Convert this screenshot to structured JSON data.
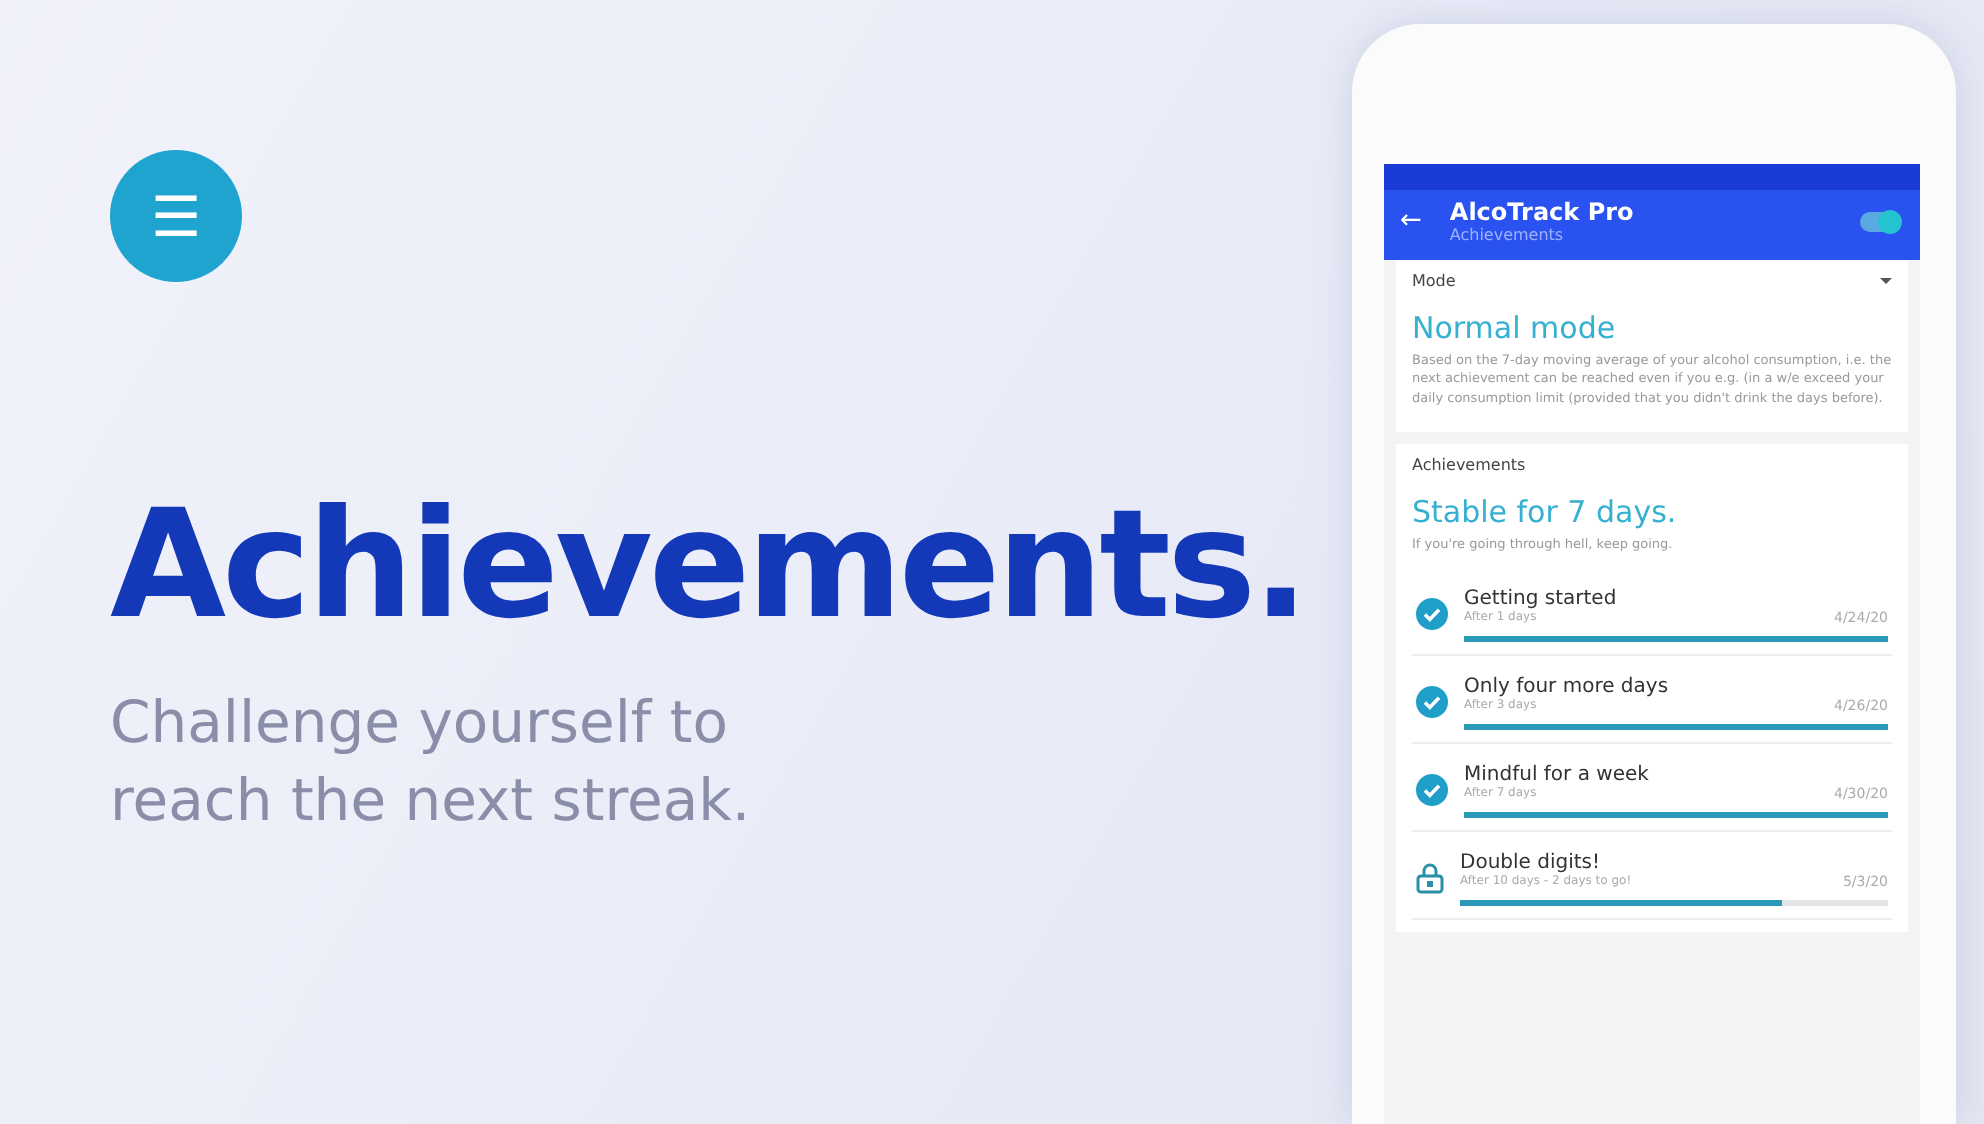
{
  "menu_button": {
    "label": "☰"
  },
  "headline": "Achievements.",
  "subtitle": "Challenge yourself to reach the next streak.",
  "phone": {
    "app_bar": {
      "back": "←",
      "title": "AlcoTrack Pro",
      "subtitle": "Achievements",
      "switch": {
        "on": true
      }
    },
    "mode_card": {
      "label": "Mode",
      "value": "Normal mode",
      "description": "Based on the 7-day moving average of your alcohol consumption, i.e. the next achievement can be reached even if you e.g. (in a w/e exceed your daily consumption limit (provided that you didn't drink the days before)."
    },
    "achievements_card": {
      "label": "Achievements",
      "title": "Stable for 7 days.",
      "motto": "If you're going through hell, keep going.",
      "items": [
        {
          "kind": "done",
          "name": "Getting started",
          "detail": "After 1 days",
          "date": "4/24/20",
          "level": 1
        },
        {
          "kind": "done",
          "name": "Only four more days",
          "detail": "After 3 days",
          "date": "4/26/20",
          "level": 1
        },
        {
          "kind": "done",
          "name": "Mindful for a week",
          "detail": "After 7 days",
          "date": "4/30/20",
          "level": 1
        },
        {
          "kind": "locked",
          "name": "Double digits!",
          "detail": "After 10 days - 2 days to go!",
          "date": "5/3/20",
          "level": 0.75
        }
      ]
    }
  }
}
